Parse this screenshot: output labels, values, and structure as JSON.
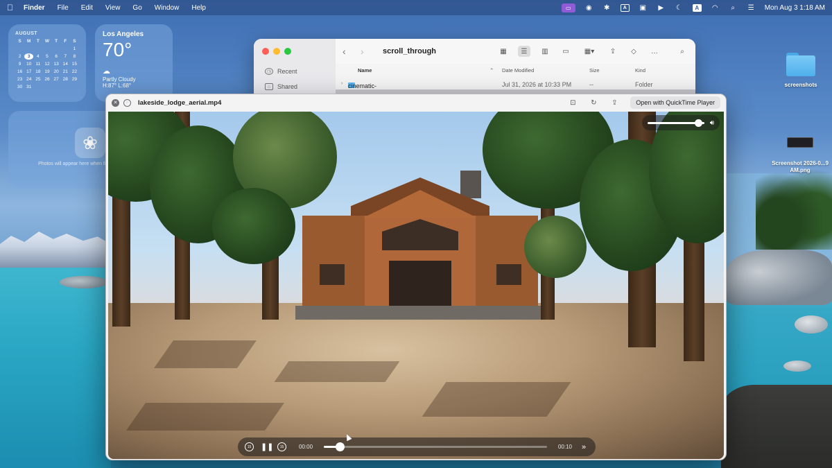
{
  "menubar": {
    "apple_icon": "apple-icon",
    "app_name": "Finder",
    "menus": [
      "File",
      "Edit",
      "View",
      "Go",
      "Window",
      "Help"
    ],
    "status_icons": [
      "screen-mirroring-icon",
      "record-icon",
      "gear-icon",
      "a-box-icon",
      "chat-icon",
      "play-circle-icon",
      "moon-icon",
      "input-source-icon",
      "wifi-icon",
      "search-icon",
      "control-center-icon"
    ],
    "input_source_label": "A",
    "datetime": "Mon Aug 3  1:18 AM"
  },
  "calendar_widget": {
    "month": "AUGUST",
    "weekdays": [
      "S",
      "M",
      "T",
      "W",
      "T",
      "F",
      "S"
    ],
    "days": [
      "",
      "",
      "",
      "",
      "",
      "",
      "1",
      "2",
      "3",
      "4",
      "5",
      "6",
      "7",
      "8",
      "9",
      "10",
      "11",
      "12",
      "13",
      "14",
      "15",
      "16",
      "17",
      "18",
      "19",
      "20",
      "21",
      "22",
      "23",
      "24",
      "25",
      "26",
      "27",
      "28",
      "29",
      "30",
      "31"
    ],
    "today": "3"
  },
  "weather_widget": {
    "city": "Los Angeles",
    "temperature": "70°",
    "condition": "Partly Cloudy",
    "high_low": "H:87° L:68°"
  },
  "photos_widget": {
    "message": "Photos will appear here when finished processing"
  },
  "desktop_icons": [
    {
      "label": "screenshots",
      "kind": "folder"
    },
    {
      "label": "Screenshot 2026-0...9 AM.png",
      "kind": "image"
    }
  ],
  "finder": {
    "title": "scroll_through",
    "sidebar": [
      {
        "label": "Recent",
        "icon": "clock-icon"
      },
      {
        "label": "Shared",
        "icon": "shared-folder-icon"
      }
    ],
    "columns": {
      "name": "Name",
      "date": "Date Modified",
      "size": "Size",
      "kind": "Kind"
    },
    "rows": [
      {
        "name": "cinematic-scroll",
        "date": "Jul 31, 2026 at 10:33 PM",
        "size": "--",
        "kind": "Folder"
      }
    ]
  },
  "quicklook": {
    "filename": "lakeside_lodge_aerial.mp4",
    "open_button": "Open with QuickTime Player",
    "volume_level": 0.9,
    "current_time": "00:00",
    "duration": "00:10",
    "progress": 0.07,
    "skip_back_label": "15",
    "skip_forward_label": "15"
  }
}
